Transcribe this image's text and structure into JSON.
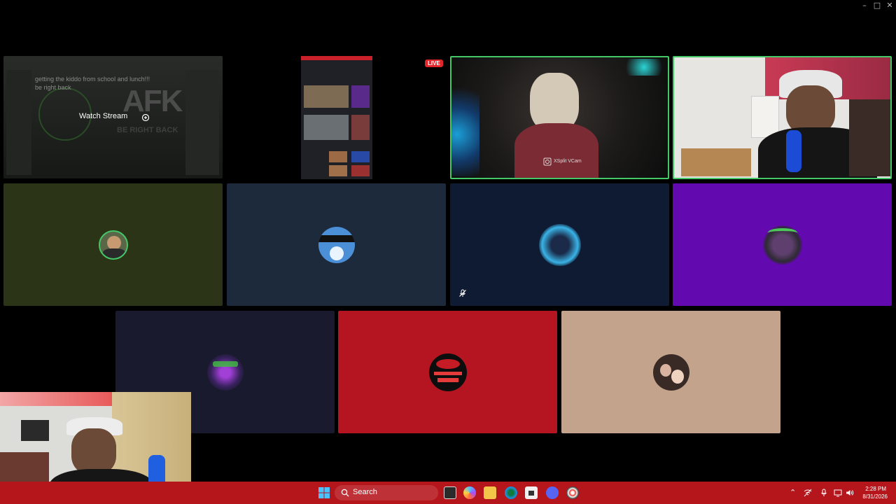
{
  "window": {
    "minimize": "–",
    "maximize": "□",
    "close": "✕"
  },
  "live_badge": "LIVE",
  "tiles": {
    "afk": {
      "chat_line1": "getting the kiddo from school and lunch!!!",
      "chat_line2": "be right back",
      "afk_title": "AFK",
      "afk_sub": "BE RIGHT BACK",
      "watch_stream": "Watch Stream"
    },
    "xsplit": {
      "label": "XSplit VCam"
    }
  },
  "taskbar": {
    "search_label": "Search",
    "time": "2:28 PM",
    "date": "8/31/2026"
  },
  "colors": {
    "accent_green": "#44c767",
    "taskbar_red": "#b5161c",
    "tile_olive": "#2c3418",
    "tile_slate": "#1c2a3c",
    "tile_navy": "#0f1b33",
    "tile_purple": "#6309b0",
    "tile_dark": "#1a1a2e",
    "tile_red": "#b51520",
    "tile_tan": "#c4a38d"
  }
}
